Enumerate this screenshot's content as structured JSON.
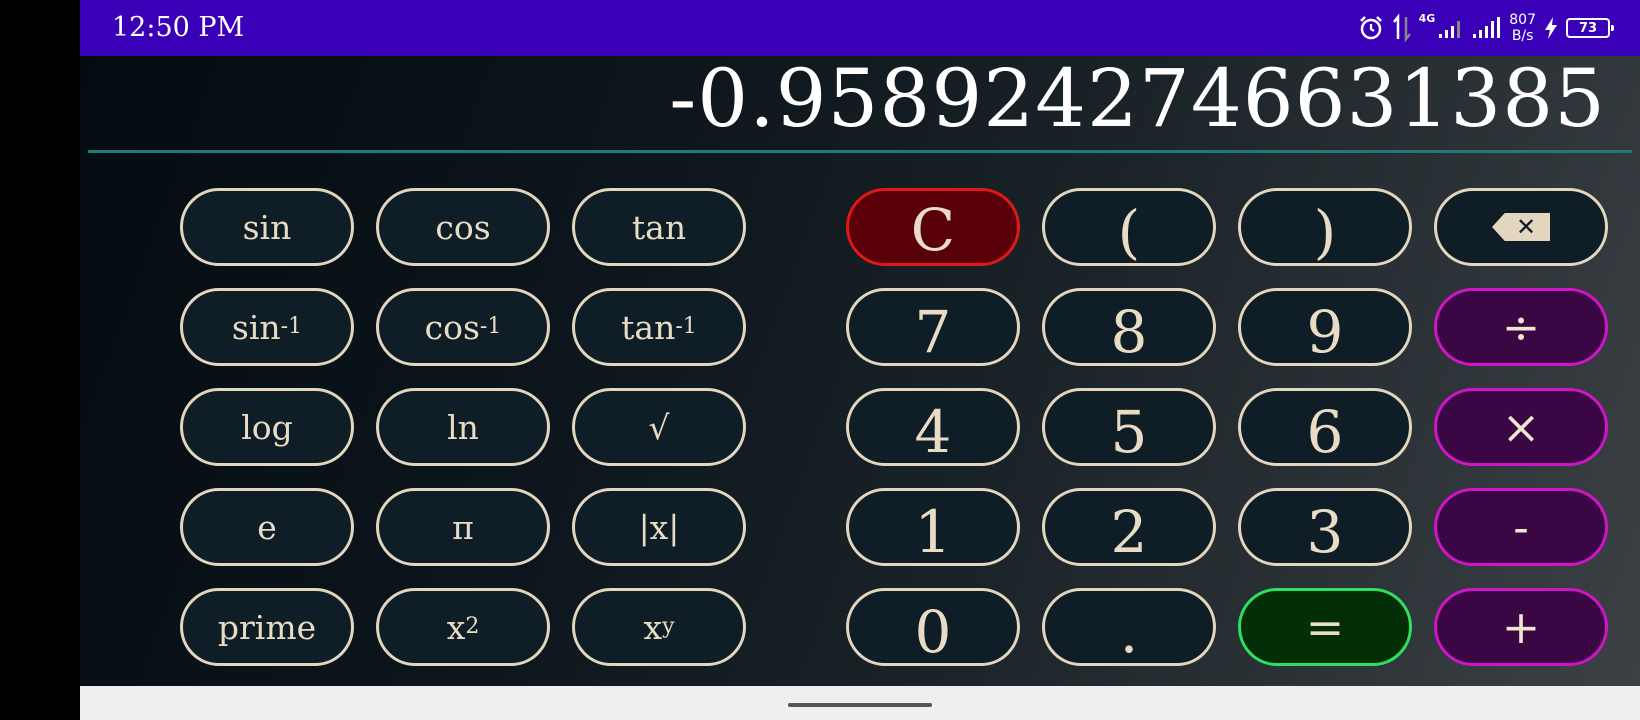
{
  "status_bar": {
    "time": "12:50 PM",
    "network_label": "4G",
    "speed_value": "807",
    "speed_unit": "B/s",
    "battery": "73"
  },
  "display": {
    "value": "-0.9589242746631385"
  },
  "colors": {
    "status_bar": "#3a00b8",
    "divider": "#1c7d78",
    "key_border": "#e2d6be",
    "clear_border": "#e01818",
    "operator_border": "#d214c8",
    "equals_border": "#2ce060"
  },
  "scientific_keys": {
    "sin": "sin",
    "cos": "cos",
    "tan": "tan",
    "asin_base": "sin",
    "asin_exp": "-1",
    "acos_base": "cos",
    "acos_exp": "-1",
    "atan_base": "tan",
    "atan_exp": "-1",
    "log": "log",
    "ln": "ln",
    "sqrt": "√",
    "e": "e",
    "pi": "π",
    "abs": "|x|",
    "prime": "prime",
    "square_base": "x",
    "square_exp": "2",
    "power_base": "x",
    "power_exp": "y"
  },
  "keypad": {
    "clear": "C",
    "open_paren": "(",
    "close_paren": ")",
    "backspace_icon": "backspace-icon",
    "seven": "7",
    "eight": "8",
    "nine": "9",
    "divide": "÷",
    "four": "4",
    "five": "5",
    "six": "6",
    "multiply": "×",
    "one": "1",
    "two": "2",
    "three": "3",
    "minus": "-",
    "zero": "0",
    "dot": ".",
    "equals": "=",
    "plus": "+"
  }
}
